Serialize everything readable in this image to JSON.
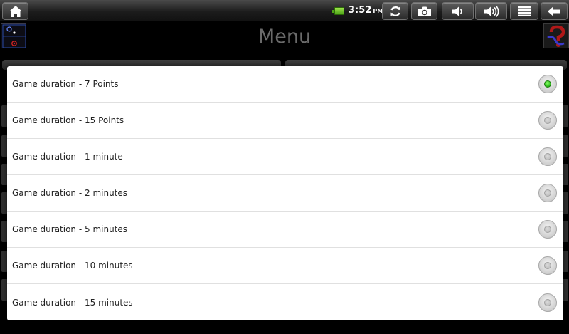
{
  "status_bar": {
    "time": "3:52",
    "ampm": "PM",
    "icons": {
      "home": "home-icon",
      "battery": "battery-icon",
      "sync": "sync-icon",
      "camera": "camera-icon",
      "volume_down": "volume-down-icon",
      "volume_up": "volume-up-icon",
      "menu": "menu-icon",
      "back": "back-arrow-icon"
    },
    "battery_color": "#5bbf1f"
  },
  "app": {
    "title": "Menu"
  },
  "dialog": {
    "options": [
      {
        "label": "Game duration - 7 Points",
        "selected": true
      },
      {
        "label": "Game duration - 15 Points",
        "selected": false
      },
      {
        "label": "Game duration - 1 minute",
        "selected": false
      },
      {
        "label": "Game duration - 2 minutes",
        "selected": false
      },
      {
        "label": "Game duration - 5 minutes",
        "selected": false
      },
      {
        "label": "Game duration - 10 minutes",
        "selected": false
      },
      {
        "label": "Game duration - 15 minutes",
        "selected": false
      }
    ],
    "selected_color": "#2fbf1c"
  }
}
